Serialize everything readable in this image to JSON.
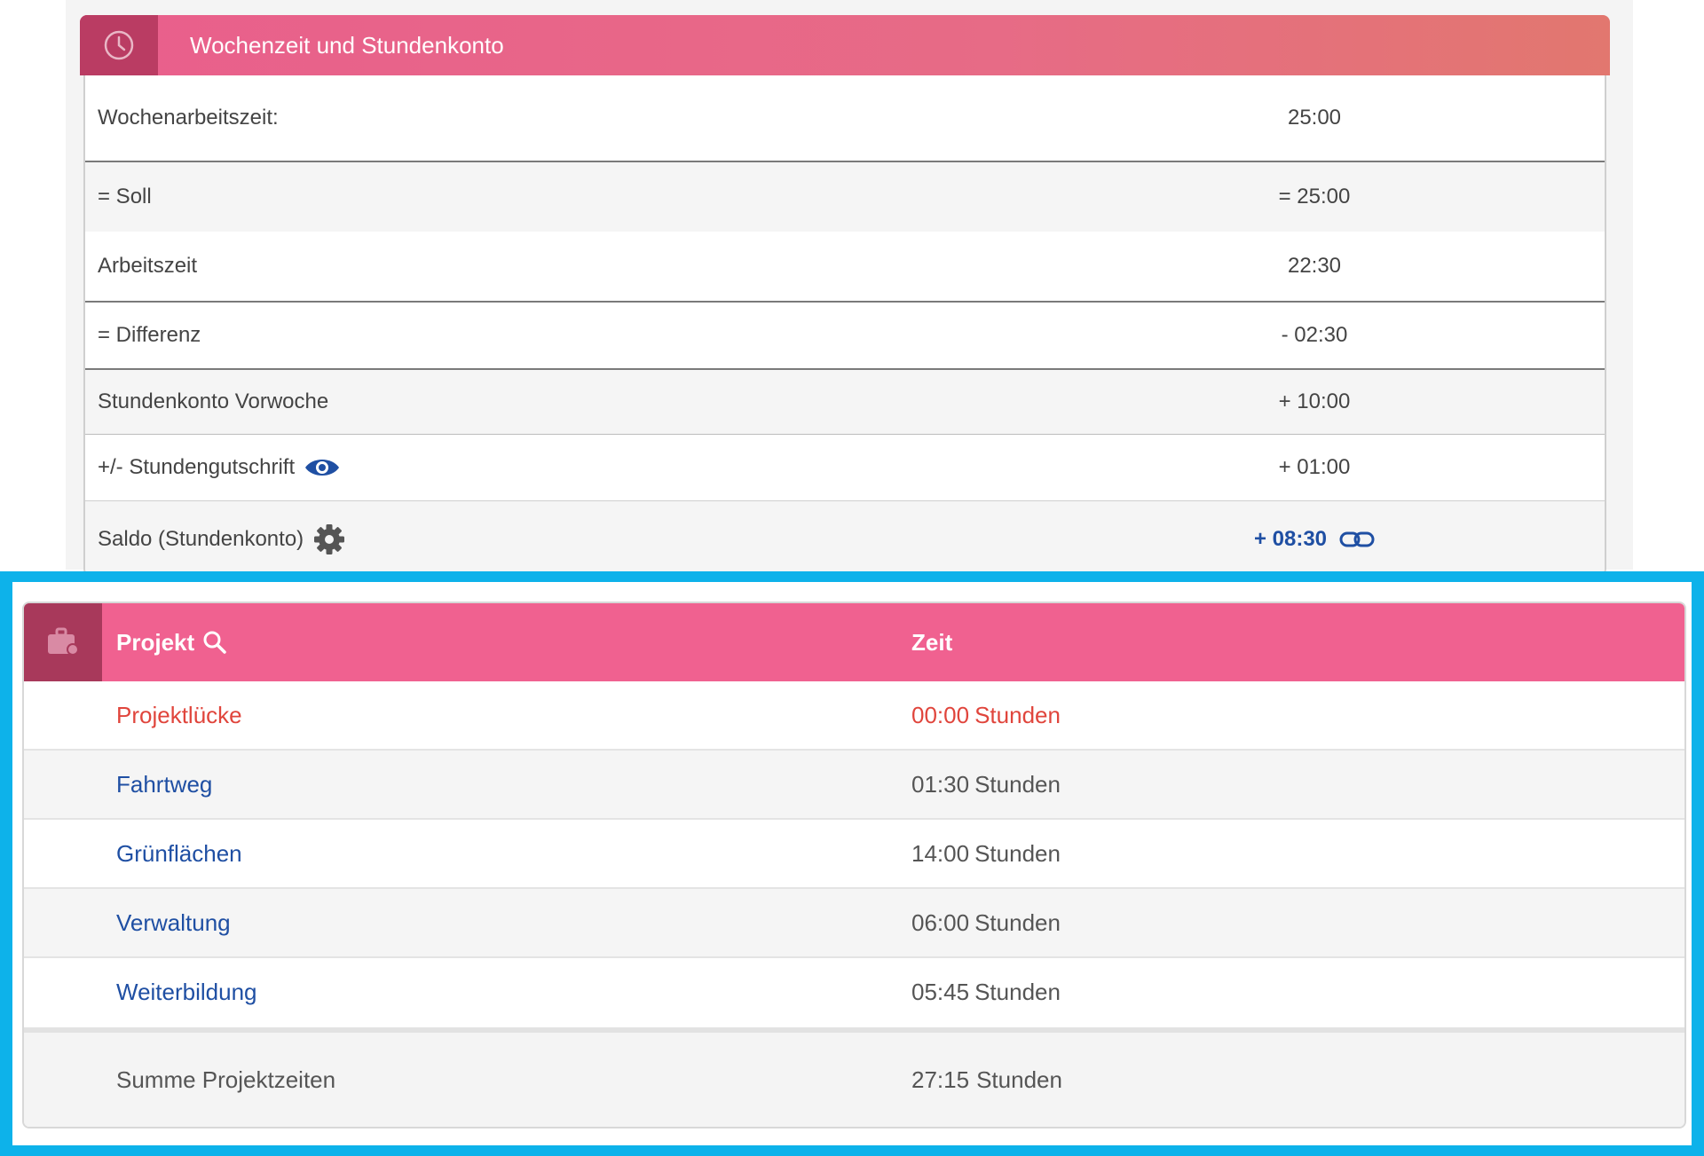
{
  "weekly": {
    "title": "Wochenzeit und Stundenkonto",
    "rows": [
      {
        "label": "Wochenarbeitszeit:",
        "value": "25:00"
      },
      {
        "label": "= Soll",
        "value": "= 25:00"
      },
      {
        "label": "Arbeitszeit",
        "value": "22:30"
      },
      {
        "label": "= Differenz",
        "value": "- 02:30"
      },
      {
        "label": "Stundenkonto Vorwoche",
        "value": "+ 10:00"
      },
      {
        "label": "+/- Stundengutschrift",
        "value": "+ 01:00"
      },
      {
        "label": "Saldo (Stundenkonto)",
        "value": "+ 08:30"
      }
    ]
  },
  "projects": {
    "header_project": "Projekt",
    "header_time": "Zeit",
    "rows": [
      {
        "name": "Projektlücke",
        "time": "00:00",
        "unit": "Stunden"
      },
      {
        "name": "Fahrtweg",
        "time": "01:30",
        "unit": "Stunden"
      },
      {
        "name": "Grünflächen",
        "time": "14:00",
        "unit": "Stunden"
      },
      {
        "name": "Verwaltung",
        "time": "06:00",
        "unit": "Stunden"
      },
      {
        "name": "Weiterbildung",
        "time": "05:45",
        "unit": "Stunden"
      }
    ],
    "sum_label": "Summe Projektzeiten",
    "sum_time": "27:15",
    "sum_unit": "Stunden"
  },
  "colors": {
    "accent_pink": "#f06190",
    "link_blue": "#1f4fa3",
    "warning_red": "#e0453c",
    "highlight": "#0db2ea"
  },
  "icons": {
    "header_top": "clock-icon",
    "header_bottom": "briefcase-icon",
    "search": "search-icon",
    "eye": "eye-icon",
    "gear": "gear-icon",
    "link": "link-icon"
  }
}
